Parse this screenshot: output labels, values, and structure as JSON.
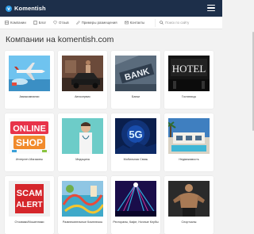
{
  "header": {
    "logo_text": "Komentish",
    "brand_color": "#1d2f4a",
    "accent_color": "#2d9de8",
    "menu_icon": "hamburger-icon"
  },
  "nav": {
    "items": [
      {
        "label": "Компании",
        "icon": "building-icon"
      },
      {
        "label": "Блог",
        "icon": "document-icon"
      },
      {
        "label": "Отзыв",
        "icon": "heart-icon"
      },
      {
        "label": "Примеры размещения",
        "icon": "pencil-icon"
      },
      {
        "label": "Контакты",
        "icon": "envelope-icon"
      }
    ],
    "search_placeholder": "Поиск по сайту",
    "search_icon": "search-icon"
  },
  "page": {
    "title": "Компании на komentish.com"
  },
  "companies": [
    {
      "label": "Авиакомпании"
    },
    {
      "label": "Автосервис"
    },
    {
      "label": "Банки"
    },
    {
      "label": "Гостиницы"
    },
    {
      "label": "Интернет-Магазины"
    },
    {
      "label": "Медицина"
    },
    {
      "label": "Мобильная Связь"
    },
    {
      "label": "Недвижимость"
    },
    {
      "label": "Отзовики/Мошенники"
    },
    {
      "label": "Развлекательные Комплексы"
    },
    {
      "label": "Рестораны, Кафе, Ночные Клубы"
    },
    {
      "label": "Спортзалы"
    }
  ],
  "thumb_texts": {
    "bank": "BANK",
    "hotel": "HOTEL",
    "online": "ONLINE",
    "shop": "SHOP",
    "fiveg": "5G",
    "scam": "SCAM",
    "alert": "ALERT"
  }
}
